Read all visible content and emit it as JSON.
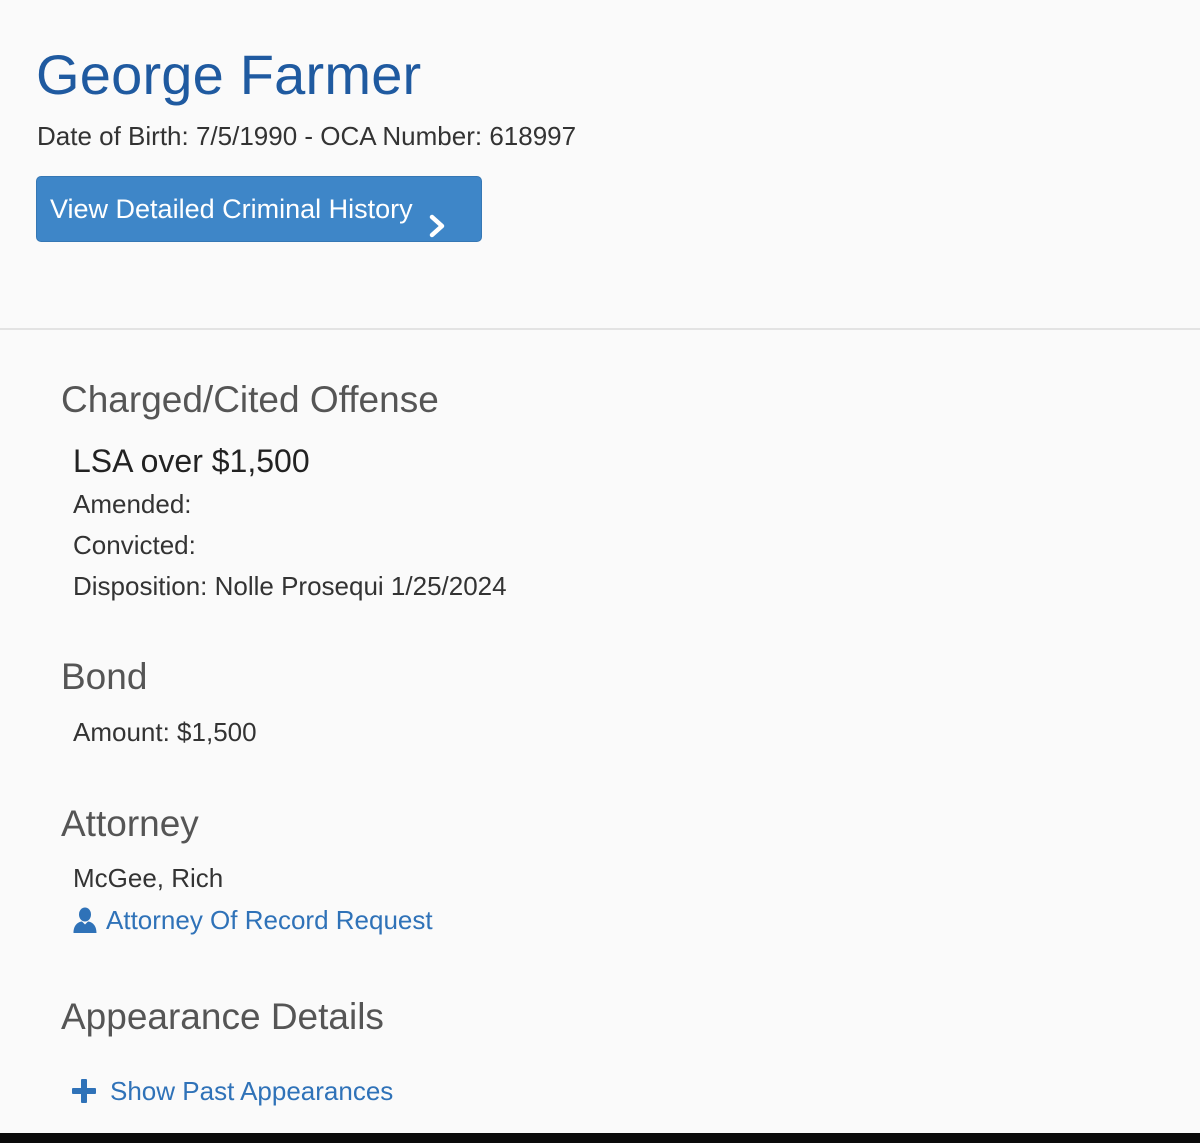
{
  "person": {
    "name": "George Farmer",
    "meta": "Date of Birth: 7/5/1990 - OCA Number: 618997",
    "history_button_label": "View Detailed Criminal History"
  },
  "offense": {
    "title": "Charged/Cited Offense",
    "name": "LSA over $1,500",
    "amended": "Amended:",
    "convicted": "Convicted:",
    "disposition": "Disposition: Nolle Prosequi 1/25/2024"
  },
  "bond": {
    "title": "Bond",
    "amount": "Amount: $1,500"
  },
  "attorney": {
    "title": "Attorney",
    "name": "McGee, Rich",
    "record_request_label": "Attorney Of Record Request"
  },
  "appearance": {
    "title": "Appearance Details",
    "show_past_label": "Show Past Appearances"
  },
  "icons": {
    "history_button": "chevron-right-icon",
    "record_request": "user-icon",
    "show_past": "plus-icon"
  },
  "colors": {
    "name_blue": "#1f5aa0",
    "button_blue": "#3e86c8",
    "link_blue": "#2f72b8"
  }
}
